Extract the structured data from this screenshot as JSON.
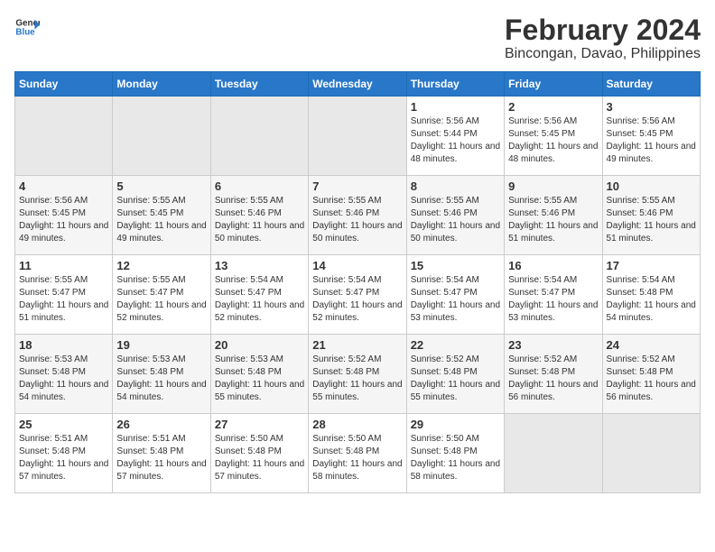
{
  "header": {
    "logo_line1": "General",
    "logo_line2": "Blue",
    "month_year": "February 2024",
    "location": "Bincongan, Davao, Philippines"
  },
  "weekdays": [
    "Sunday",
    "Monday",
    "Tuesday",
    "Wednesday",
    "Thursday",
    "Friday",
    "Saturday"
  ],
  "weeks": [
    [
      {
        "day": "",
        "sunrise": "",
        "sunset": "",
        "daylight": ""
      },
      {
        "day": "",
        "sunrise": "",
        "sunset": "",
        "daylight": ""
      },
      {
        "day": "",
        "sunrise": "",
        "sunset": "",
        "daylight": ""
      },
      {
        "day": "",
        "sunrise": "",
        "sunset": "",
        "daylight": ""
      },
      {
        "day": "1",
        "sunrise": "Sunrise: 5:56 AM",
        "sunset": "Sunset: 5:44 PM",
        "daylight": "Daylight: 11 hours and 48 minutes."
      },
      {
        "day": "2",
        "sunrise": "Sunrise: 5:56 AM",
        "sunset": "Sunset: 5:45 PM",
        "daylight": "Daylight: 11 hours and 48 minutes."
      },
      {
        "day": "3",
        "sunrise": "Sunrise: 5:56 AM",
        "sunset": "Sunset: 5:45 PM",
        "daylight": "Daylight: 11 hours and 49 minutes."
      }
    ],
    [
      {
        "day": "4",
        "sunrise": "Sunrise: 5:56 AM",
        "sunset": "Sunset: 5:45 PM",
        "daylight": "Daylight: 11 hours and 49 minutes."
      },
      {
        "day": "5",
        "sunrise": "Sunrise: 5:55 AM",
        "sunset": "Sunset: 5:45 PM",
        "daylight": "Daylight: 11 hours and 49 minutes."
      },
      {
        "day": "6",
        "sunrise": "Sunrise: 5:55 AM",
        "sunset": "Sunset: 5:46 PM",
        "daylight": "Daylight: 11 hours and 50 minutes."
      },
      {
        "day": "7",
        "sunrise": "Sunrise: 5:55 AM",
        "sunset": "Sunset: 5:46 PM",
        "daylight": "Daylight: 11 hours and 50 minutes."
      },
      {
        "day": "8",
        "sunrise": "Sunrise: 5:55 AM",
        "sunset": "Sunset: 5:46 PM",
        "daylight": "Daylight: 11 hours and 50 minutes."
      },
      {
        "day": "9",
        "sunrise": "Sunrise: 5:55 AM",
        "sunset": "Sunset: 5:46 PM",
        "daylight": "Daylight: 11 hours and 51 minutes."
      },
      {
        "day": "10",
        "sunrise": "Sunrise: 5:55 AM",
        "sunset": "Sunset: 5:46 PM",
        "daylight": "Daylight: 11 hours and 51 minutes."
      }
    ],
    [
      {
        "day": "11",
        "sunrise": "Sunrise: 5:55 AM",
        "sunset": "Sunset: 5:47 PM",
        "daylight": "Daylight: 11 hours and 51 minutes."
      },
      {
        "day": "12",
        "sunrise": "Sunrise: 5:55 AM",
        "sunset": "Sunset: 5:47 PM",
        "daylight": "Daylight: 11 hours and 52 minutes."
      },
      {
        "day": "13",
        "sunrise": "Sunrise: 5:54 AM",
        "sunset": "Sunset: 5:47 PM",
        "daylight": "Daylight: 11 hours and 52 minutes."
      },
      {
        "day": "14",
        "sunrise": "Sunrise: 5:54 AM",
        "sunset": "Sunset: 5:47 PM",
        "daylight": "Daylight: 11 hours and 52 minutes."
      },
      {
        "day": "15",
        "sunrise": "Sunrise: 5:54 AM",
        "sunset": "Sunset: 5:47 PM",
        "daylight": "Daylight: 11 hours and 53 minutes."
      },
      {
        "day": "16",
        "sunrise": "Sunrise: 5:54 AM",
        "sunset": "Sunset: 5:47 PM",
        "daylight": "Daylight: 11 hours and 53 minutes."
      },
      {
        "day": "17",
        "sunrise": "Sunrise: 5:54 AM",
        "sunset": "Sunset: 5:48 PM",
        "daylight": "Daylight: 11 hours and 54 minutes."
      }
    ],
    [
      {
        "day": "18",
        "sunrise": "Sunrise: 5:53 AM",
        "sunset": "Sunset: 5:48 PM",
        "daylight": "Daylight: 11 hours and 54 minutes."
      },
      {
        "day": "19",
        "sunrise": "Sunrise: 5:53 AM",
        "sunset": "Sunset: 5:48 PM",
        "daylight": "Daylight: 11 hours and 54 minutes."
      },
      {
        "day": "20",
        "sunrise": "Sunrise: 5:53 AM",
        "sunset": "Sunset: 5:48 PM",
        "daylight": "Daylight: 11 hours and 55 minutes."
      },
      {
        "day": "21",
        "sunrise": "Sunrise: 5:52 AM",
        "sunset": "Sunset: 5:48 PM",
        "daylight": "Daylight: 11 hours and 55 minutes."
      },
      {
        "day": "22",
        "sunrise": "Sunrise: 5:52 AM",
        "sunset": "Sunset: 5:48 PM",
        "daylight": "Daylight: 11 hours and 55 minutes."
      },
      {
        "day": "23",
        "sunrise": "Sunrise: 5:52 AM",
        "sunset": "Sunset: 5:48 PM",
        "daylight": "Daylight: 11 hours and 56 minutes."
      },
      {
        "day": "24",
        "sunrise": "Sunrise: 5:52 AM",
        "sunset": "Sunset: 5:48 PM",
        "daylight": "Daylight: 11 hours and 56 minutes."
      }
    ],
    [
      {
        "day": "25",
        "sunrise": "Sunrise: 5:51 AM",
        "sunset": "Sunset: 5:48 PM",
        "daylight": "Daylight: 11 hours and 57 minutes."
      },
      {
        "day": "26",
        "sunrise": "Sunrise: 5:51 AM",
        "sunset": "Sunset: 5:48 PM",
        "daylight": "Daylight: 11 hours and 57 minutes."
      },
      {
        "day": "27",
        "sunrise": "Sunrise: 5:50 AM",
        "sunset": "Sunset: 5:48 PM",
        "daylight": "Daylight: 11 hours and 57 minutes."
      },
      {
        "day": "28",
        "sunrise": "Sunrise: 5:50 AM",
        "sunset": "Sunset: 5:48 PM",
        "daylight": "Daylight: 11 hours and 58 minutes."
      },
      {
        "day": "29",
        "sunrise": "Sunrise: 5:50 AM",
        "sunset": "Sunset: 5:48 PM",
        "daylight": "Daylight: 11 hours and 58 minutes."
      },
      {
        "day": "",
        "sunrise": "",
        "sunset": "",
        "daylight": ""
      },
      {
        "day": "",
        "sunrise": "",
        "sunset": "",
        "daylight": ""
      }
    ]
  ]
}
